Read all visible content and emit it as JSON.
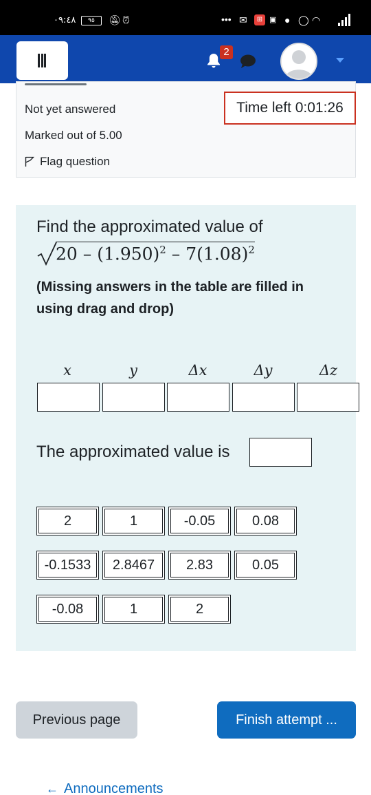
{
  "status_bar": {
    "time": "٠٩:٤٨",
    "battery": "٩٥"
  },
  "nav": {
    "notification_count": "2"
  },
  "question_info": {
    "state": "Not yet answered",
    "marks": "Marked out of 5.00",
    "flag_label": "Flag question"
  },
  "timer": {
    "label": "Time left 0:01:26"
  },
  "question": {
    "prompt": "Find the approximated value of",
    "formula": {
      "a": "20",
      "b": "(1.950)",
      "b_exp": "2",
      "c": "7(1.08)",
      "c_exp": "2",
      "op": "–"
    },
    "note": "(Missing answers in the table are filled in using drag and drop)",
    "table_headers": [
      "x",
      "y",
      "Δx",
      "Δy",
      "Δz"
    ],
    "approx_label": "The approximated value is",
    "choices": [
      "2",
      "1",
      "-0.05",
      "0.08",
      "-0.1533",
      "2.8467",
      "2.83",
      "0.05",
      "-0.08",
      "1",
      "2"
    ]
  },
  "buttons": {
    "previous": "Previous page",
    "finish": "Finish attempt ..."
  },
  "footer": {
    "announcements": "Announcements"
  }
}
